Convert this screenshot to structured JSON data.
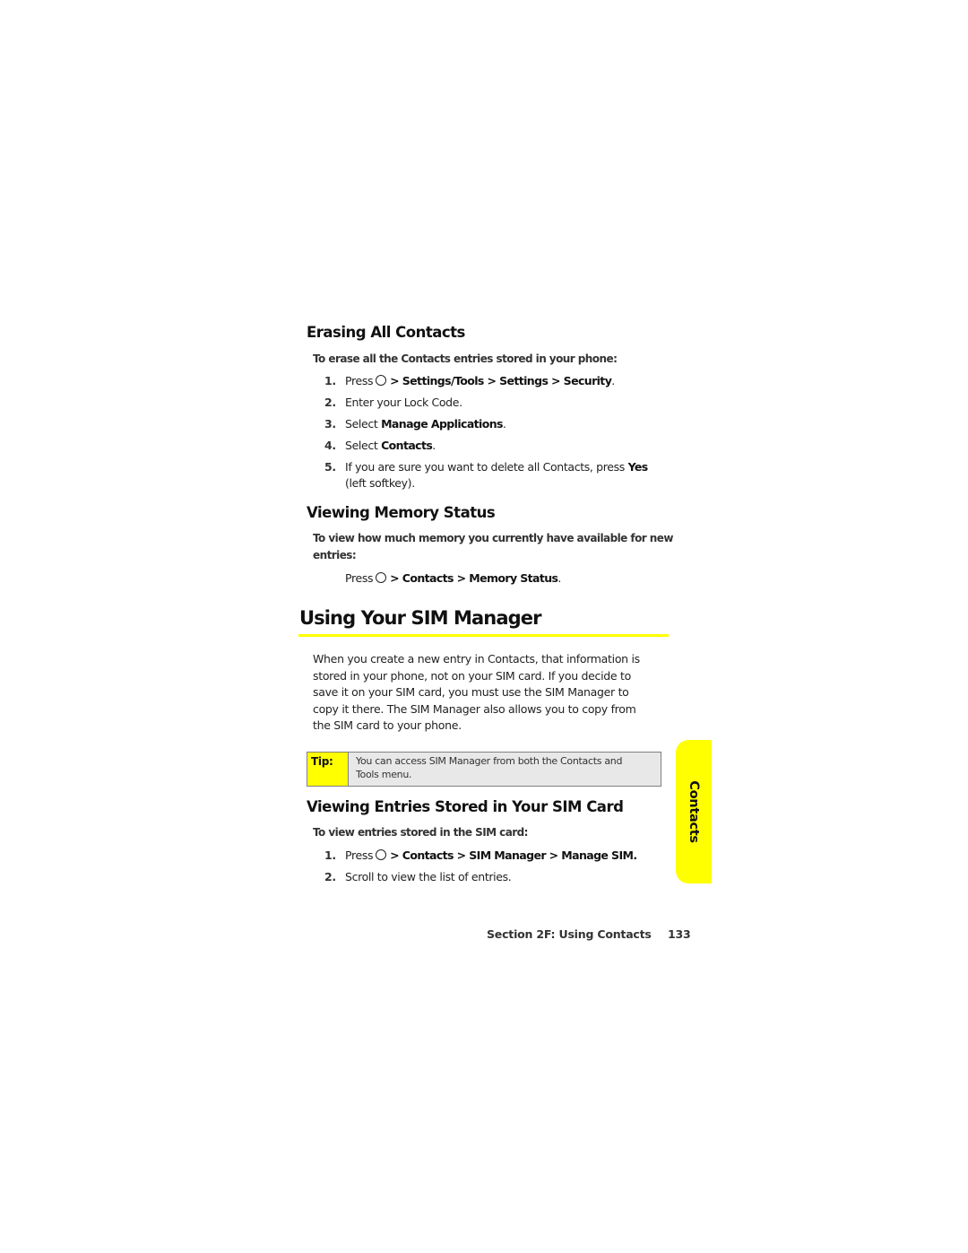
{
  "sections": {
    "erasing": {
      "heading": "Erasing All Contacts",
      "intro": "To erase all the Contacts entries stored in your phone:",
      "steps": [
        {
          "num": "1.",
          "prefix": "Press",
          "icon": "menu-key-circle-icon",
          "path": "> Settings/Tools > Settings > Security",
          "suffix": "."
        },
        {
          "num": "2.",
          "text": "Enter your Lock Code."
        },
        {
          "num": "3.",
          "prefix": "Select ",
          "bold": "Manage Applications",
          "suffix": "."
        },
        {
          "num": "4.",
          "prefix": "Select ",
          "bold": "Contacts",
          "suffix": "."
        },
        {
          "num": "5.",
          "line1_prefix": "If you are sure you want to delete all Contacts, press ",
          "line1_bold": "Yes",
          "line2": "(left softkey)."
        }
      ]
    },
    "memory": {
      "heading": "Viewing Memory Status",
      "intro_line1": "To view how much memory you currently have available for new",
      "intro_line2": "entries:",
      "press": "Press",
      "icon": "menu-key-circle-icon",
      "path": "> Contacts > Memory Status",
      "suffix": "."
    },
    "sim_manager": {
      "heading": "Using Your SIM Manager",
      "paragraph_lines": [
        "When you create a new entry in Contacts, that information is",
        "stored in your phone, not on your SIM card. If you decide to",
        "save it on your SIM card, you must use the SIM Manager to",
        "copy it there. The SIM Manager also allows you to copy from",
        "the SIM card to your phone."
      ],
      "tip": {
        "label": "Tip:",
        "line1": "You can access SIM Manager from both the Contacts and",
        "line2": "Tools menu."
      }
    },
    "viewing_entries": {
      "heading": "Viewing Entries Stored in Your SIM Card",
      "intro": "To view entries stored in the SIM card:",
      "steps": [
        {
          "num": "1.",
          "prefix": "Press",
          "icon": "menu-key-circle-icon",
          "path": "> Contacts > SIM Manager > Manage SIM."
        },
        {
          "num": "2.",
          "text": "Scroll to view the list of entries."
        }
      ]
    }
  },
  "side_tab": {
    "label": "Contacts",
    "color": "#ffff00"
  },
  "footer": {
    "section": "Section 2F: Using Contacts",
    "page": "133"
  },
  "colors": {
    "accent": "#ffff00",
    "tip_background": "#e8e8e8",
    "tip_border": "#808080"
  }
}
